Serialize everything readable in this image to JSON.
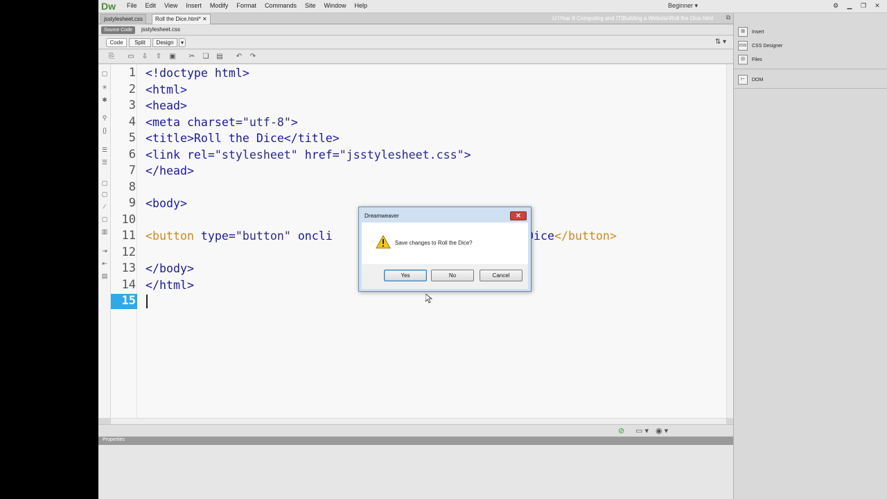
{
  "app": {
    "logo": "Dw",
    "menu": [
      "File",
      "Edit",
      "View",
      "Insert",
      "Modify",
      "Format",
      "Commands",
      "Site",
      "Window",
      "Help"
    ],
    "workspace": "Beginner"
  },
  "tabs": [
    {
      "label": "jsstylesheet.css"
    },
    {
      "label": "Roll the Dice.html*"
    }
  ],
  "doc_path": "U:\\Year 8 Computing and IT\\Building a Website\\Roll the Dice.html",
  "related": {
    "source_code": "Source Code",
    "file": "jsstylesheet.css"
  },
  "view_modes": {
    "code": "Code",
    "split": "Split",
    "design": "Design"
  },
  "code": {
    "line_numbers": [
      "1",
      "2",
      "3",
      "4",
      "5",
      "6",
      "7",
      "8",
      "9",
      "10",
      "11",
      "12",
      "13",
      "14",
      "15"
    ],
    "active_line": "15",
    "lines": {
      "l1": "<!doctype html>",
      "l2": "<html>",
      "l3": "<head>",
      "l4a": "<meta charset=",
      "l4b": "\"utf-8\"",
      "l4c": ">",
      "l5": "<title>Roll the Dice</title>",
      "l6a": "<link rel=",
      "l6b": "\"stylesheet\"",
      "l6c": " href=",
      "l6d": "\"jsstylesheet.css\"",
      "l6e": ">",
      "l7": "</head>",
      "l9": "<body>",
      "l11a": "<button",
      "l11b": " type=",
      "l11c": "\"button\"",
      "l11d": " oncli",
      "l11e": "Dice",
      "l11f": "</button>",
      "l13": "</body>",
      "l14": "</html>"
    }
  },
  "properties": {
    "title": "Properties"
  },
  "right_panel": {
    "items": [
      "Insert",
      "CSS Designer",
      "Files",
      "DOM"
    ]
  },
  "dialog": {
    "title": "Dreamweaver",
    "message": "Save changes to Roll the Dice?",
    "buttons": {
      "yes": "Yes",
      "no": "No",
      "cancel": "Cancel"
    }
  },
  "colors": {
    "tag": "#1a1a9a",
    "button_tag": "#d08a18",
    "active_line_bg": "#2fa9e8"
  }
}
